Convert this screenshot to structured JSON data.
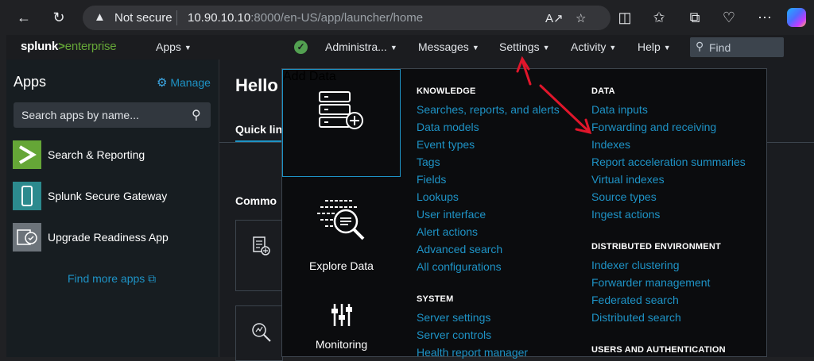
{
  "browser": {
    "security_label": "Not secure",
    "url_host": "10.90.10.10",
    "url_rest": ":8000/en-US/app/launcher/home"
  },
  "splunk": {
    "logo_left": "splunk",
    "logo_gt": ">",
    "logo_right": "enterprise",
    "nav": {
      "apps": "Apps",
      "administrator": "Administra...",
      "messages": "Messages",
      "settings": "Settings",
      "activity": "Activity",
      "help": "Help",
      "find_placeholder": "Find"
    }
  },
  "sidebar": {
    "title": "Apps",
    "manage": "Manage",
    "search_placeholder": "Search apps by name...",
    "apps": [
      {
        "label": "Search & Reporting",
        "color": "#65a637"
      },
      {
        "label": "Splunk Secure Gateway",
        "color": "#2c8a8e"
      },
      {
        "label": "Upgrade Readiness App",
        "color": "#6c737a"
      }
    ],
    "find_more": "Find more apps"
  },
  "main": {
    "hello": "Hello",
    "quick_links": "Quick lin",
    "common": "Commo"
  },
  "settings_menu": {
    "tiles": [
      {
        "label": "Add Data"
      },
      {
        "label": "Explore Data"
      },
      {
        "label": "Monitoring"
      }
    ],
    "knowledge": {
      "heading": "KNOWLEDGE",
      "items": [
        "Searches, reports, and alerts",
        "Data models",
        "Event types",
        "Tags",
        "Fields",
        "Lookups",
        "User interface",
        "Alert actions",
        "Advanced search",
        "All configurations"
      ]
    },
    "system": {
      "heading": "SYSTEM",
      "items": [
        "Server settings",
        "Server controls",
        "Health report manager"
      ]
    },
    "data": {
      "heading": "DATA",
      "items": [
        "Data inputs",
        "Forwarding and receiving",
        "Indexes",
        "Report acceleration summaries",
        "Virtual indexes",
        "Source types",
        "Ingest actions"
      ]
    },
    "distributed": {
      "heading": "DISTRIBUTED ENVIRONMENT",
      "items": [
        "Indexer clustering",
        "Forwarder management",
        "Federated search",
        "Distributed search"
      ]
    },
    "users": {
      "heading": "USERS AND AUTHENTICATION"
    }
  },
  "colors": {
    "link": "#1e93c6",
    "annotation_arrow": "#e0162b",
    "brand_green": "#65a637"
  }
}
